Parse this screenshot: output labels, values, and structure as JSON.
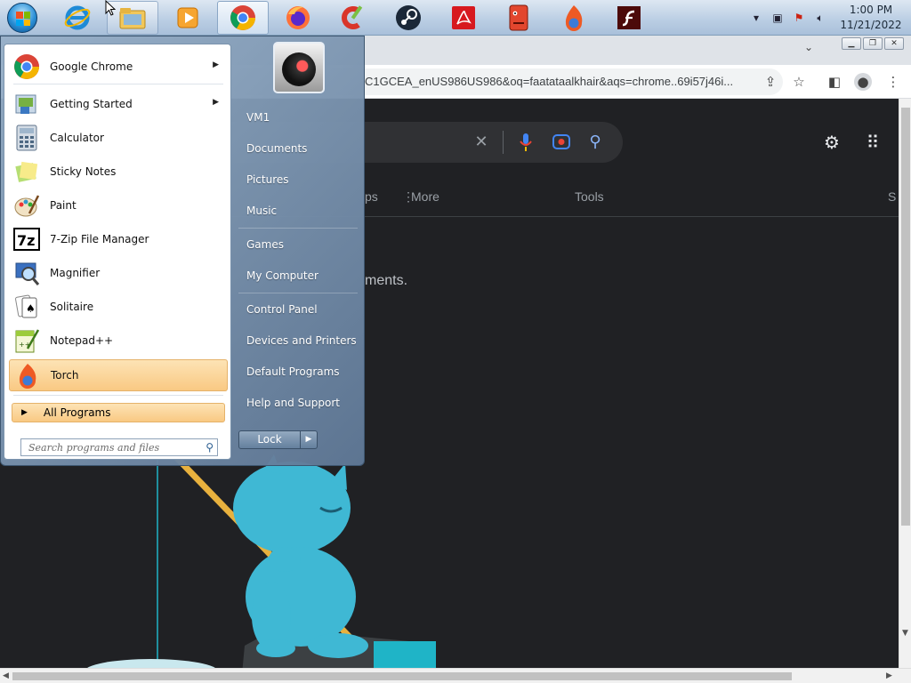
{
  "taskbar": {
    "items": [
      {
        "name": "Internet Explorer"
      },
      {
        "name": "Windows Explorer"
      },
      {
        "name": "Windows Media Player"
      },
      {
        "name": "Google Chrome"
      },
      {
        "name": "Firefox"
      },
      {
        "name": "CCleaner"
      },
      {
        "name": "Steam"
      },
      {
        "name": "Adobe Reader"
      },
      {
        "name": "Unknown App"
      },
      {
        "name": "Torch"
      },
      {
        "name": "Flash Player"
      }
    ],
    "clock": {
      "time": "1:00 PM",
      "date": "11/21/2022"
    }
  },
  "browser": {
    "url": "C1GCEA_enUS986US986&oq=faatataalkhair&aqs=chrome..69i57j46i...",
    "nav": {
      "apps_fragment": "ps",
      "more": "More",
      "tools": "Tools",
      "s_fragment": "S"
    },
    "content_fragment": "ments."
  },
  "start_menu": {
    "programs": [
      {
        "label": "Google Chrome",
        "has_submenu": true,
        "icon": "chrome-icon"
      },
      {
        "label": "Getting Started",
        "has_submenu": true,
        "icon": "getting-started-icon"
      },
      {
        "label": "Calculator",
        "has_submenu": false,
        "icon": "calculator-icon"
      },
      {
        "label": "Sticky Notes",
        "has_submenu": false,
        "icon": "sticky-notes-icon"
      },
      {
        "label": "Paint",
        "has_submenu": false,
        "icon": "paint-icon"
      },
      {
        "label": "7-Zip File Manager",
        "has_submenu": false,
        "icon": "7zip-icon"
      },
      {
        "label": "Magnifier",
        "has_submenu": false,
        "icon": "magnifier-icon"
      },
      {
        "label": "Solitaire",
        "has_submenu": false,
        "icon": "solitaire-icon"
      },
      {
        "label": "Notepad++",
        "has_submenu": false,
        "icon": "notepadpp-icon"
      },
      {
        "label": "Torch",
        "has_submenu": false,
        "icon": "torch-icon",
        "highlighted": true
      }
    ],
    "all_programs": "All Programs",
    "search_placeholder": "Search programs and files",
    "right_items": [
      "VM1",
      "Documents",
      "Pictures",
      "Music",
      "Games",
      "My Computer",
      "Control Panel",
      "Devices and Printers",
      "Default Programs",
      "Help and Support"
    ],
    "lock_label": "Lock"
  }
}
